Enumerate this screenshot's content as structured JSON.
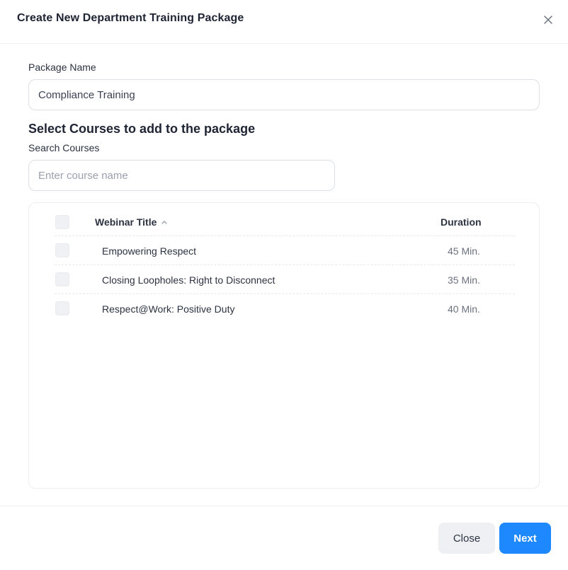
{
  "dialog": {
    "title": "Create New Department Training Package"
  },
  "form": {
    "package_name_label": "Package Name",
    "package_name_value": "Compliance Training",
    "section_title": "Select Courses to add to the package",
    "search_label": "Search Courses",
    "search_placeholder": "Enter course name"
  },
  "table": {
    "columns": {
      "title": "Webinar Title",
      "duration": "Duration"
    },
    "sort_icon": "chevron-up-icon",
    "rows": [
      {
        "title": "Empowering Respect",
        "duration": "45 Min."
      },
      {
        "title": "Closing Loopholes: Right to Disconnect",
        "duration": "35 Min."
      },
      {
        "title": "Respect@Work: Positive Duty",
        "duration": "40 Min."
      }
    ]
  },
  "footer": {
    "close_label": "Close",
    "next_label": "Next"
  },
  "colors": {
    "primary": "#1e88ff",
    "secondary_bg": "#eef0f3",
    "text": "#1e2433"
  }
}
